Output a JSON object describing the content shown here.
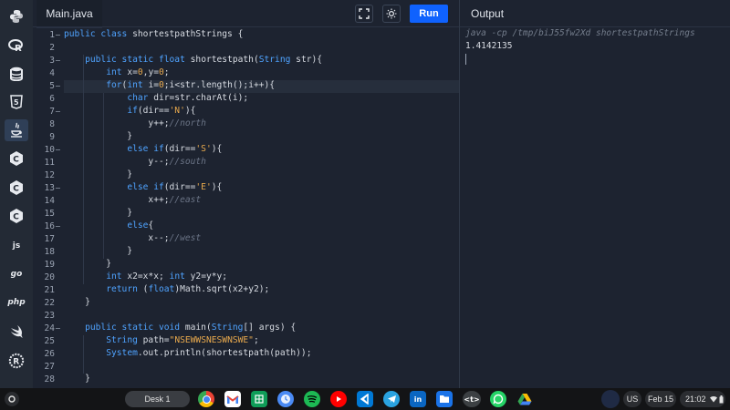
{
  "editor": {
    "tab_label": "Main.java",
    "run_label": "Run",
    "line_numbers": [
      "1",
      "2",
      "3",
      "4",
      "5",
      "6",
      "7",
      "8",
      "9",
      "10",
      "11",
      "12",
      "13",
      "14",
      "15",
      "16",
      "17",
      "18",
      "19",
      "20",
      "21",
      "22",
      "23",
      "24",
      "25",
      "26",
      "27",
      "28"
    ],
    "code_lines": [
      [
        [
          "k",
          "public class "
        ],
        [
          "o",
          "shortestpathStrings {"
        ]
      ],
      [],
      [
        [
          "o",
          "    "
        ],
        [
          "k",
          "public static float "
        ],
        [
          "o",
          "shortestpath("
        ],
        [
          "k",
          "String "
        ],
        [
          "o",
          "str){"
        ]
      ],
      [
        [
          "o",
          "        "
        ],
        [
          "k",
          "int "
        ],
        [
          "o",
          "x="
        ],
        [
          "n",
          "0"
        ],
        [
          "o",
          ",y="
        ],
        [
          "n",
          "0"
        ],
        [
          "o",
          ";"
        ]
      ],
      [
        [
          "o",
          "        "
        ],
        [
          "k",
          "for"
        ],
        [
          "o",
          "("
        ],
        [
          "k",
          "int "
        ],
        [
          "o",
          "i="
        ],
        [
          "n",
          "0"
        ],
        [
          "o",
          ";i<str.length();i++){"
        ]
      ],
      [
        [
          "o",
          "            "
        ],
        [
          "k",
          "char "
        ],
        [
          "o",
          "dir=str.charAt(i);"
        ]
      ],
      [
        [
          "o",
          "            "
        ],
        [
          "k",
          "if"
        ],
        [
          "o",
          "(dir=="
        ],
        [
          "s",
          "'N'"
        ],
        [
          "o",
          "){"
        ]
      ],
      [
        [
          "o",
          "                y++;"
        ],
        [
          "c",
          "//north"
        ]
      ],
      [
        [
          "o",
          "            }"
        ]
      ],
      [
        [
          "o",
          "            "
        ],
        [
          "k",
          "else if"
        ],
        [
          "o",
          "(dir=="
        ],
        [
          "s",
          "'S'"
        ],
        [
          "o",
          "){"
        ]
      ],
      [
        [
          "o",
          "                y--;"
        ],
        [
          "c",
          "//south"
        ]
      ],
      [
        [
          "o",
          "            }"
        ]
      ],
      [
        [
          "o",
          "            "
        ],
        [
          "k",
          "else if"
        ],
        [
          "o",
          "(dir=="
        ],
        [
          "s",
          "'E'"
        ],
        [
          "o",
          "){"
        ]
      ],
      [
        [
          "o",
          "                x++;"
        ],
        [
          "c",
          "//east"
        ]
      ],
      [
        [
          "o",
          "            }"
        ]
      ],
      [
        [
          "o",
          "            "
        ],
        [
          "k",
          "else"
        ],
        [
          "o",
          "{"
        ]
      ],
      [
        [
          "o",
          "                x--;"
        ],
        [
          "c",
          "//west"
        ]
      ],
      [
        [
          "o",
          "            }"
        ]
      ],
      [
        [
          "o",
          "        }"
        ]
      ],
      [
        [
          "o",
          "        "
        ],
        [
          "k",
          "int "
        ],
        [
          "o",
          "x2=x*x; "
        ],
        [
          "k",
          "int "
        ],
        [
          "o",
          "y2=y*y;"
        ]
      ],
      [
        [
          "o",
          "        "
        ],
        [
          "k",
          "return "
        ],
        [
          "o",
          "("
        ],
        [
          "k",
          "float"
        ],
        [
          "o",
          ")Math.sqrt(x2+y2);"
        ]
      ],
      [
        [
          "o",
          "    }"
        ]
      ],
      [],
      [
        [
          "o",
          "    "
        ],
        [
          "k",
          "public static void "
        ],
        [
          "o",
          "main("
        ],
        [
          "k",
          "String"
        ],
        [
          "o",
          "[] args) {"
        ]
      ],
      [
        [
          "o",
          "        "
        ],
        [
          "k",
          "String "
        ],
        [
          "o",
          "path="
        ],
        [
          "s",
          "\"NSEWWSNESWNSWE\""
        ],
        [
          "o",
          ";"
        ]
      ],
      [
        [
          "o",
          "        "
        ],
        [
          "k",
          "System"
        ],
        [
          "o",
          ".out.println(shortestpath(path));"
        ]
      ],
      [],
      [
        [
          "o",
          "    }"
        ]
      ]
    ]
  },
  "output": {
    "title": "Output",
    "command": "java -cp /tmp/biJ55fw2Xd shortestpathStrings",
    "result": "1.4142135"
  },
  "sidebar": {
    "items": [
      "python-icon",
      "r-icon",
      "database-icon",
      "html5-icon",
      "java-icon",
      "c-icon",
      "cpp-icon",
      "csharp-icon",
      "js",
      "go",
      "php",
      "swift-icon",
      "rust-icon"
    ]
  },
  "shelf": {
    "desk_label": "Desk 1",
    "apps": [
      "chrome-icon",
      "gmail-icon",
      "sheets-icon",
      "clock-icon",
      "spotify-icon",
      "youtube-icon",
      "vscode-icon",
      "telegram-icon",
      "linkedin-icon",
      "files-icon",
      "code-tag-icon",
      "whatsapp-icon",
      "drive-icon"
    ],
    "code_tag_text": "<t>",
    "linkedin_text": "in",
    "lang": "US",
    "date": "Feb 15",
    "time": "21:02"
  },
  "colors": {
    "run_button": "#0f62fe",
    "keyword": "#4fa3ff",
    "string": "#e8a94d",
    "comment": "#6b7486"
  }
}
